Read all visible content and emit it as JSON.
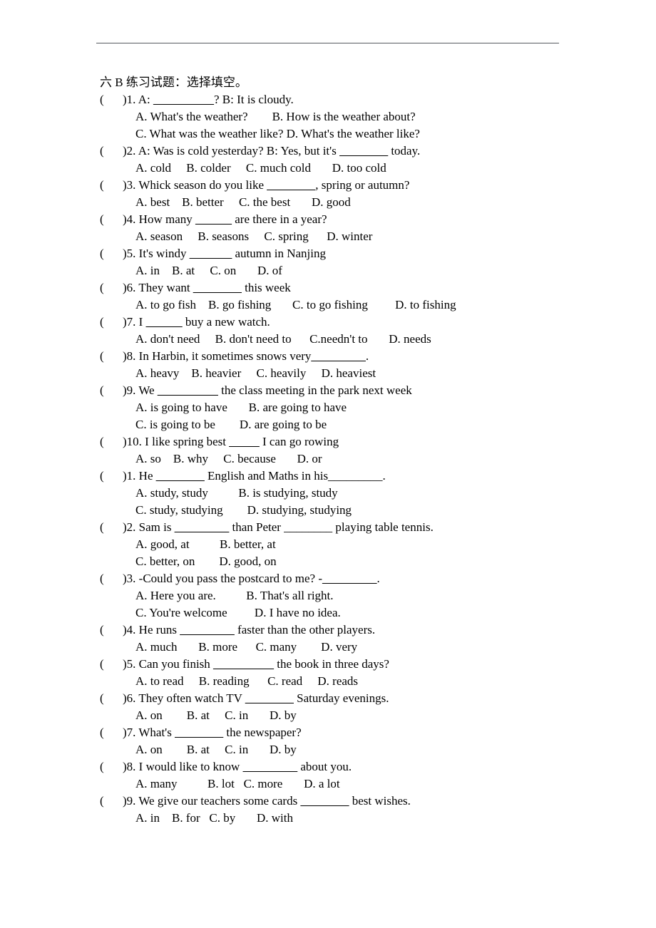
{
  "document": {
    "title": "六 B 练习试题：选择填空。",
    "header_rule_color": "#555a60"
  },
  "questions": [
    {
      "number": ")1.",
      "stem_before": " A: ",
      "blank": "__________",
      "stem_after": "? B: It is cloudy.",
      "option_lines": [
        "A. What's the weather?        B. How is the weather about?",
        "C. What was the weather like? D. What's the weather like?"
      ]
    },
    {
      "number": ")2.",
      "stem_before": " A: Was is cold yesterday? B: Yes, but it's ",
      "blank": "________",
      "stem_after": " today.",
      "option_lines": [
        "A. cold     B. colder     C. much cold       D. too cold"
      ]
    },
    {
      "number": ")3.",
      "stem_before": " Whick season do you like ",
      "blank": "________",
      "stem_after": ", spring or autumn?",
      "option_lines": [
        "A. best    B. better     C. the best       D. good"
      ]
    },
    {
      "number": ")4.",
      "stem_before": " How many ",
      "blank": "______",
      "stem_after": " are there in a year?",
      "option_lines": [
        "A. season     B. seasons     C. spring      D. winter"
      ]
    },
    {
      "number": ")5.",
      "stem_before": " It's windy ",
      "blank": "_______",
      "stem_after": " autumn in Nanjing",
      "option_lines": [
        "A. in    B. at     C. on       D. of"
      ]
    },
    {
      "number": ")6.",
      "stem_before": " They want ",
      "blank": "________",
      "stem_after": " this week",
      "option_lines": [
        "A. to go fish    B. go fishing       C. to go fishing         D. to fishing"
      ]
    },
    {
      "number": ")7.",
      "stem_before": " I ",
      "blank": "______",
      "stem_after": " buy a new watch.",
      "option_lines": [
        "A. don't need     B. don't need to      C.needn't to       D. needs"
      ]
    },
    {
      "number": ")8.",
      "stem_before": " In Harbin, it sometimes snows very",
      "blank": "_________",
      "stem_after": ".",
      "option_lines": [
        "A. heavy    B. heavier     C. heavily     D. heaviest"
      ]
    },
    {
      "number": ")9.",
      "stem_before": " We ",
      "blank": "__________",
      "stem_after": " the class meeting in the park next week",
      "option_lines": [
        "A. is going to have       B. are going to have",
        "C. is going to be        D. are going to be"
      ]
    },
    {
      "number": ")10.",
      "stem_before": " I like spring best ",
      "blank": "_____",
      "stem_after": " I can go rowing",
      "option_lines": [
        "A. so    B. why     C. because       D. or"
      ]
    },
    {
      "number": ")1.",
      "stem_before": " He ",
      "blank": "________",
      "stem_after": " English and Maths in his_________.",
      "option_lines": [
        "A. study, study          B. is studying, study",
        "C. study, studying        D. studying, studying"
      ]
    },
    {
      "number": ")2.",
      "stem_before": " Sam is ",
      "blank": "_________",
      "stem_after": " than Peter ________ playing table tennis.",
      "option_lines": [
        "A. good, at          B. better, at",
        "C. better, on        D. good, on"
      ]
    },
    {
      "number": ")3.",
      "stem_before": " -Could you pass the postcard to me? -",
      "blank": "_________",
      "stem_after": ".",
      "option_lines": [
        "A. Here you are.          B. That's all right.",
        "C. You're welcome         D. I have no idea."
      ]
    },
    {
      "number": ")4.",
      "stem_before": " He runs ",
      "blank": "_________",
      "stem_after": " faster than the other players.",
      "option_lines": [
        "A. much       B. more      C. many        D. very"
      ]
    },
    {
      "number": ")5.",
      "stem_before": " Can you finish ",
      "blank": "__________",
      "stem_after": " the book in three days?",
      "option_lines": [
        "A. to read     B. reading      C. read     D. reads"
      ]
    },
    {
      "number": ")6.",
      "stem_before": " They often watch TV ",
      "blank": "________",
      "stem_after": " Saturday evenings.",
      "option_lines": [
        "A. on        B. at     C. in       D. by"
      ]
    },
    {
      "number": ")7.",
      "stem_before": " What's ",
      "blank": "________",
      "stem_after": " the newspaper?",
      "option_lines": [
        "A. on        B. at     C. in       D. by"
      ]
    },
    {
      "number": ")8.",
      "stem_before": " I would like to know ",
      "blank": "_________",
      "stem_after": " about you.",
      "option_lines": [
        "A. many          B. lot   C. more       D. a lot"
      ]
    },
    {
      "number": ")9.",
      "stem_before": " We give our teachers some cards ",
      "blank": "________",
      "stem_after": " best wishes.",
      "option_lines": [
        "A. in    B. for   C. by       D. with"
      ]
    }
  ]
}
